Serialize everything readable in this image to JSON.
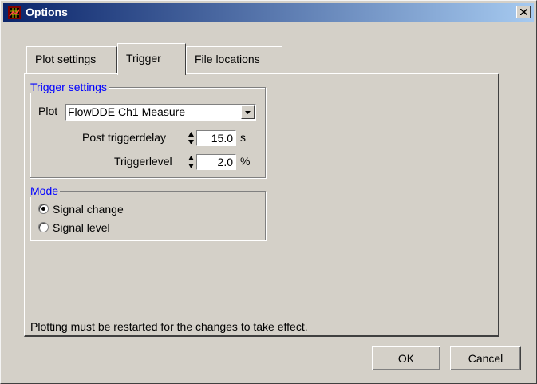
{
  "window": {
    "title": "Options"
  },
  "tabs": [
    {
      "label": "Plot settings"
    },
    {
      "label": "Trigger",
      "selected": true
    },
    {
      "label": "File locations"
    }
  ],
  "trigger_settings": {
    "legend": "Trigger settings",
    "plot_label": "Plot",
    "plot_value": "FlowDDE Ch1 Measure",
    "post_trigger_label": "Post triggerdelay",
    "post_trigger_value": "15.0",
    "post_trigger_unit": "s",
    "triggerlevel_label": "Triggerlevel",
    "triggerlevel_value": "2.0",
    "triggerlevel_unit": "%"
  },
  "mode": {
    "legend": "Mode",
    "options": [
      {
        "label": "Signal change",
        "checked": true
      },
      {
        "label": "Signal level",
        "checked": false
      }
    ]
  },
  "note": "Plotting must be restarted for the changes to take effect.",
  "buttons": {
    "ok": "OK",
    "cancel": "Cancel"
  },
  "colors": {
    "titlebar_start": "#0a246a",
    "titlebar_end": "#a6caf0",
    "face": "#d4d0c8",
    "legend": "#0000ff"
  },
  "icons": {
    "app": "chart-grid-icon",
    "close": "close-icon",
    "dropdown": "chevron-down-icon",
    "spin": "spin-arrows-icon"
  }
}
